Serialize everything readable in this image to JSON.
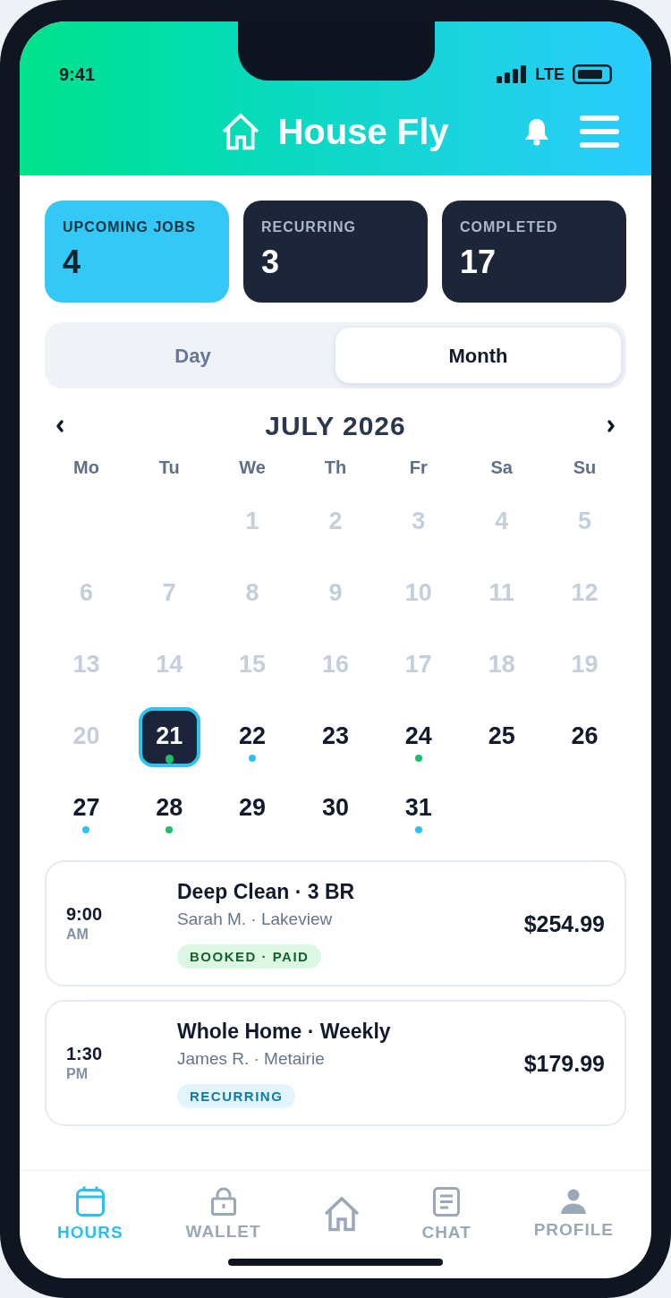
{
  "status_bar": {
    "time": "9:41",
    "network": "LTE"
  },
  "header": {
    "title": "House Fly"
  },
  "stats": [
    {
      "label": "UPCOMING JOBS",
      "value": "4",
      "selected": true
    },
    {
      "label": "RECURRING",
      "value": "3",
      "selected": false
    },
    {
      "label": "COMPLETED",
      "value": "17",
      "selected": false
    }
  ],
  "view_tabs": [
    {
      "label": "Day",
      "selected": false
    },
    {
      "label": "Month",
      "selected": true
    }
  ],
  "calendar": {
    "month": "JULY 2026",
    "weekdays": [
      "Mo",
      "Tu",
      "We",
      "Th",
      "Fr",
      "Sa",
      "Su"
    ],
    "days": [
      {
        "label": "1",
        "past": true,
        "selected": false
      },
      {
        "label": "2",
        "past": true,
        "selected": false
      },
      {
        "label": "3",
        "past": true,
        "selected": false
      },
      {
        "label": "4",
        "past": true,
        "selected": false
      },
      {
        "label": "5",
        "past": true,
        "selected": false
      },
      {
        "label": "6",
        "past": true,
        "selected": false
      },
      {
        "label": "7",
        "past": true,
        "selected": false
      },
      {
        "label": "8",
        "past": true,
        "selected": false
      },
      {
        "label": "9",
        "past": true,
        "selected": false
      },
      {
        "label": "10",
        "past": true,
        "selected": false
      },
      {
        "label": "11",
        "past": true,
        "selected": false
      },
      {
        "label": "12",
        "past": true,
        "selected": false
      },
      {
        "label": "13",
        "past": true,
        "selected": false
      },
      {
        "label": "14",
        "past": true,
        "selected": false
      },
      {
        "label": "15",
        "past": true,
        "selected": false
      },
      {
        "label": "16",
        "past": true,
        "selected": false
      },
      {
        "label": "17",
        "past": true,
        "selected": false
      },
      {
        "label": "18",
        "past": true,
        "selected": false
      },
      {
        "label": "19",
        "past": true,
        "selected": false
      },
      {
        "label": "20",
        "past": true,
        "selected": false
      },
      {
        "label": "21",
        "past": false,
        "selected": true,
        "color": "#1fbf6a"
      },
      {
        "label": "22",
        "past": false,
        "selected": false,
        "color": "#2cc3ef"
      },
      {
        "label": "23",
        "past": false,
        "selected": false
      },
      {
        "label": "24",
        "past": false,
        "selected": false,
        "color": "#1fbf6a"
      },
      {
        "label": "25",
        "past": false,
        "selected": false
      },
      {
        "label": "26",
        "past": false,
        "selected": false
      },
      {
        "label": "27",
        "past": false,
        "selected": false,
        "color": "#2cc3ef"
      },
      {
        "label": "28",
        "past": false,
        "selected": false,
        "color": "#1fbf6a"
      },
      {
        "label": "29",
        "past": false,
        "selected": false
      },
      {
        "label": "30",
        "past": false,
        "selected": false
      },
      {
        "label": "31",
        "past": false,
        "selected": false,
        "color": "#2cc3ef"
      }
    ]
  },
  "jobs": [
    {
      "time": "9:00",
      "period": "AM",
      "title": "Deep Clean · 3 BR",
      "client": "Sarah M. · Lakeview",
      "status": "BOOKED · PAID",
      "kind": "booked",
      "price": "$254.99"
    },
    {
      "time": "1:30",
      "period": "PM",
      "title": "Whole Home · Weekly",
      "client": "James R. · Metairie",
      "status": "RECURRING",
      "kind": "recurring",
      "price": "$179.99"
    }
  ],
  "bottom_nav": [
    {
      "kind": "tab",
      "label": "HOURS",
      "selected": true
    },
    {
      "kind": "tab",
      "label": "WALLET",
      "selected": false
    },
    {
      "kind": "home",
      "selected": false
    },
    {
      "kind": "tab",
      "label": "CHAT",
      "selected": false
    },
    {
      "kind": "tab",
      "label": "PROFILE",
      "selected": false
    }
  ]
}
